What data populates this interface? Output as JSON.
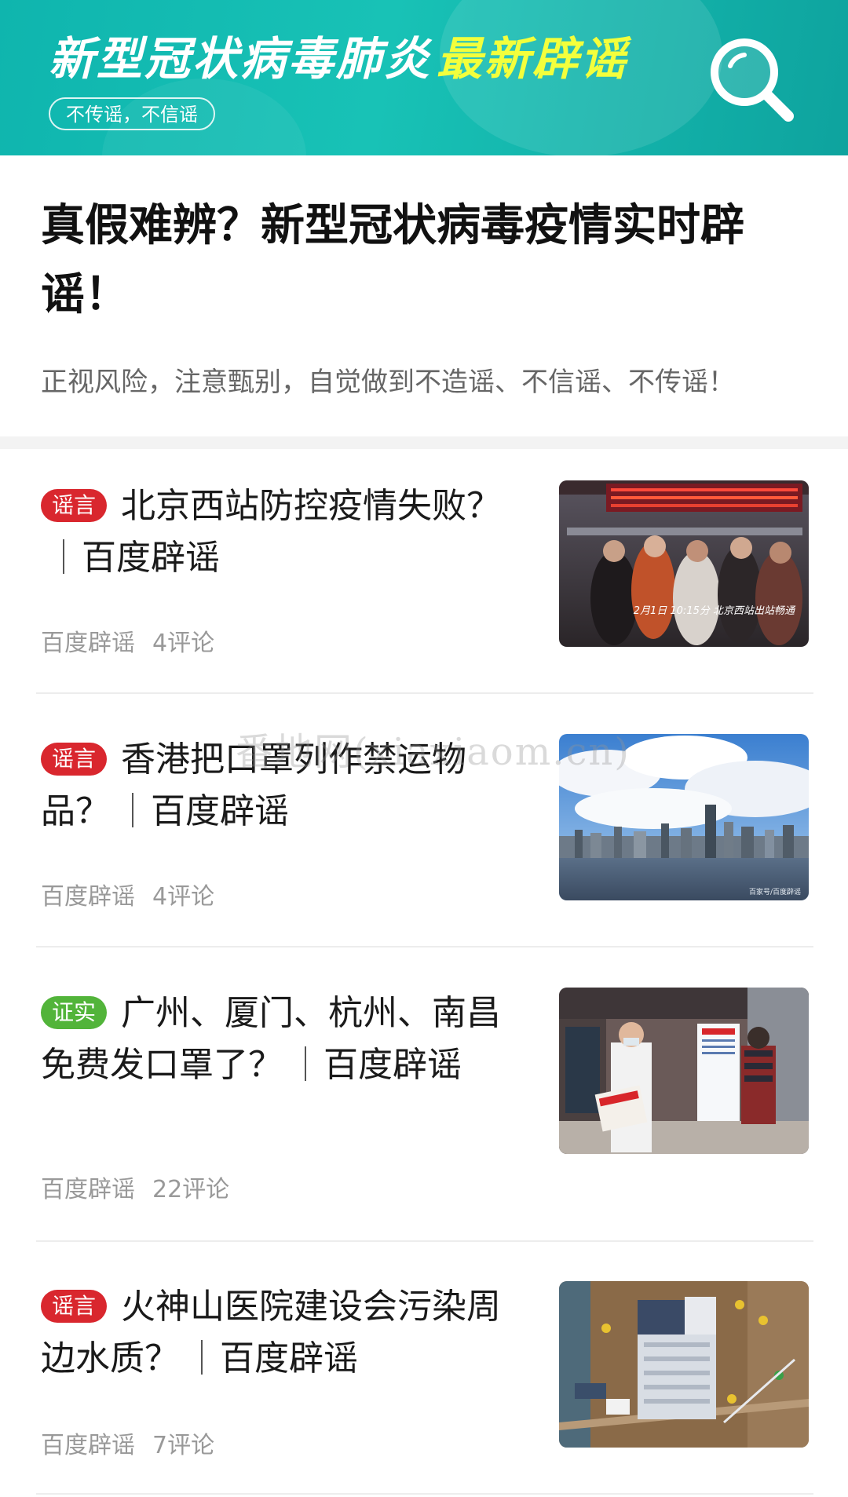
{
  "banner": {
    "title_main": "新型冠状病毒肺炎",
    "title_accent": "最新辟谣",
    "pill": "不传谣，不信谣",
    "accent_color": "#f3ff3c",
    "icon": "magnifier-icon"
  },
  "headline": {
    "title": "真假难辨？新型冠状病毒疫情实时辟谣！",
    "subtitle": "正视风险，注意甄别，自觉做到不造谣、不信谣、不传谣！"
  },
  "articles": [
    {
      "tag": "谣言",
      "tag_color": "#d9272e",
      "title": "北京西站防控疫情失败？",
      "source_label": "百度辟谣",
      "meta_source": "百度辟谣",
      "comments": "4评论",
      "image_caption": "2月1日 10:15分  北京西站出站畅通",
      "image_desc": "station-crowd"
    },
    {
      "tag": "谣言",
      "tag_color": "#d9272e",
      "title": "香港把口罩列作禁运物品？",
      "source_label": "百度辟谣",
      "meta_source": "百度辟谣",
      "comments": "4评论",
      "image_caption": "百家号/百度辟谣",
      "image_desc": "skyline"
    },
    {
      "tag": "证实",
      "tag_color": "#52b43a",
      "title": "广州、厦门、杭州、南昌免费发口罩了？",
      "source_label": "百度辟谣",
      "meta_source": "百度辟谣",
      "comments": "22评论",
      "image_caption": "",
      "image_desc": "pharmacy"
    },
    {
      "tag": "谣言",
      "tag_color": "#d9272e",
      "title": "火神山医院建设会污染周边水质？",
      "source_label": "百度辟谣",
      "meta_source": "百度辟谣",
      "comments": "7评论",
      "image_caption": "",
      "image_desc": "construction-aerial"
    }
  ],
  "watermark": "番地网(xiaxiaom.cn)"
}
